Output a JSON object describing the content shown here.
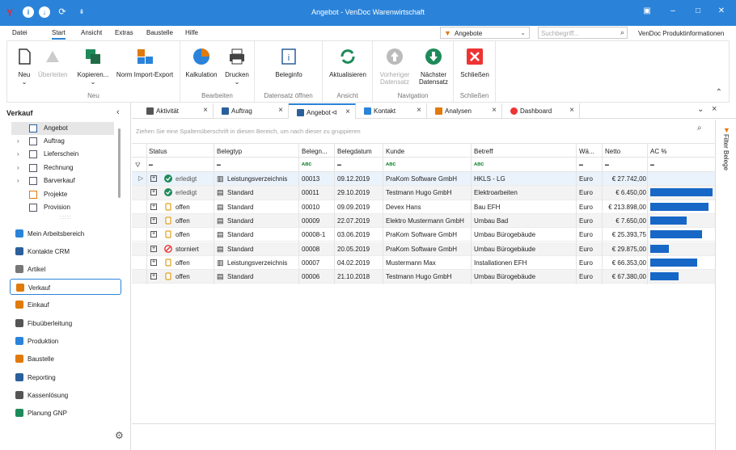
{
  "window": {
    "title": "Angebot - VenDoc Warenwirtschaft"
  },
  "menu": [
    "Datei",
    "Start",
    "Ansicht",
    "Extras",
    "Baustelle",
    "Hilfe"
  ],
  "menu_active": "Start",
  "filter_dropdown": {
    "value": "Angebote"
  },
  "search": {
    "placeholder": "Suchbegriff..."
  },
  "product_info": "VenDoc Produktinformationen",
  "ribbon": {
    "groups": [
      {
        "label": "Neu",
        "buttons": [
          "Neu",
          "Überleiten",
          "Kopieren...",
          "Norm Import-Export"
        ]
      },
      {
        "label": "Bearbeiten",
        "buttons": [
          "Kalkulation",
          "Drucken"
        ]
      },
      {
        "label": "Datensatz öffnen",
        "buttons": [
          "Beleginfo"
        ]
      },
      {
        "label": "Ansicht",
        "buttons": [
          "Aktualisieren"
        ]
      },
      {
        "label": "Navigation",
        "buttons": [
          "Vorheriger Datensatz",
          "Nächster Datensatz"
        ]
      },
      {
        "label": "Schließen",
        "buttons": [
          "Schließen"
        ]
      }
    ]
  },
  "sidebar": {
    "header": "Verkauf",
    "tree": [
      "Angebot",
      "Auftrag",
      "Lieferschein",
      "Rechnung",
      "Barverkauf",
      "Projekte",
      "Provision"
    ],
    "nav": [
      "Mein Arbeitsbereich",
      "Kontakte CRM",
      "Artikel",
      "Verkauf",
      "Einkauf",
      "Fibuüberleitung",
      "Produktion",
      "Baustelle",
      "Reporting",
      "Kassenlösung",
      "Planung GNP"
    ]
  },
  "tabs": [
    "Aktivität",
    "Auftrag",
    "Angebot",
    "Kontakt",
    "Analysen",
    "Dashboard"
  ],
  "grid": {
    "group_hint": "Ziehen Sie eine Spaltenüberschrift in diesen Bereich, um nach dieser zu gruppieren",
    "columns": [
      "Status",
      "Belegtyp",
      "Belegn...",
      "Belegdatum",
      "Kunde",
      "Betreff",
      "Wä...",
      "Netto",
      "AC %"
    ],
    "rows": [
      {
        "status": "erledigt",
        "typ": "Leistungsverzeichnis",
        "nr": "00013",
        "datum": "09.12.2019",
        "kunde": "PraKom Software GmbH",
        "betreff": "HKLS - LG",
        "wae": "Euro",
        "netto": "€ 27.742,00",
        "ac": 0
      },
      {
        "status": "erledigt",
        "typ": "Standard",
        "nr": "00011",
        "datum": "29.10.2019",
        "kunde": "Testmann Hugo GmbH",
        "betreff": "Elektroarbeiten",
        "wae": "Euro",
        "netto": "€ 6.450,00",
        "ac": 100
      },
      {
        "status": "offen",
        "typ": "Standard",
        "nr": "00010",
        "datum": "09.09.2019",
        "kunde": "Devex Hans",
        "betreff": "Bau EFH",
        "wae": "Euro",
        "netto": "€ 213.898,00",
        "ac": 94
      },
      {
        "status": "offen",
        "typ": "Standard",
        "nr": "00009",
        "datum": "22.07.2019",
        "kunde": "Elektro Mustermann GmbH",
        "betreff": "Umbau Bad",
        "wae": "Euro",
        "netto": "€ 7.650,00",
        "ac": 58
      },
      {
        "status": "offen",
        "typ": "Standard",
        "nr": "00008-1",
        "datum": "03.06.2019",
        "kunde": "PraKom Software GmbH",
        "betreff": "Umbau Bürogebäude",
        "wae": "Euro",
        "netto": "€ 25.393,75",
        "ac": 83
      },
      {
        "status": "storniert",
        "typ": "Standard",
        "nr": "00008",
        "datum": "20.05.2019",
        "kunde": "PraKom Software GmbH",
        "betreff": "Umbau Bürogebäude",
        "wae": "Euro",
        "netto": "€ 29.875,00",
        "ac": 30
      },
      {
        "status": "offen",
        "typ": "Leistungsverzeichnis",
        "nr": "00007",
        "datum": "04.02.2019",
        "kunde": "Mustermann Max",
        "betreff": "Installationen EFH",
        "wae": "Euro",
        "netto": "€ 66.353,00",
        "ac": 75
      },
      {
        "status": "offen",
        "typ": "Standard",
        "nr": "00006",
        "datum": "21.10.2018",
        "kunde": "Testmann Hugo GmbH",
        "betreff": "Umbau Bürogebäude",
        "wae": "Euro",
        "netto": "€ 67.380,00",
        "ac": 45
      }
    ]
  },
  "right_panel": "Filter Belege",
  "colors": {
    "accent": "#2b83d9",
    "bar": "#1767c7",
    "ok": "#1e8a5a",
    "cancel": "#e33",
    "open": "#e0a020"
  }
}
